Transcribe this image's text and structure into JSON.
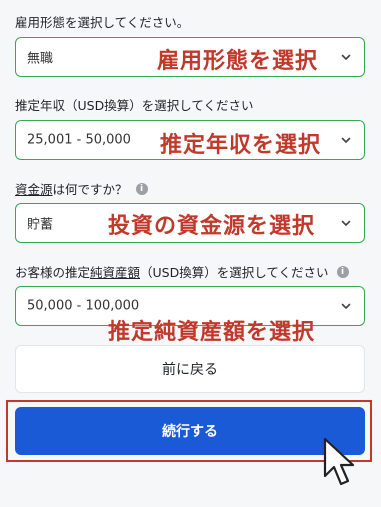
{
  "employment": {
    "label": "雇用形態を選択してください。",
    "value": "無職",
    "annotation": "雇用形態を選択"
  },
  "income": {
    "label": "推定年収（USD換算）を選択してください",
    "value": "25,001 - 50,000",
    "annotation": "推定年収を選択"
  },
  "source": {
    "label_prefix": "資金源",
    "label_rest": "は何ですか？",
    "value": "貯蓄",
    "annotation": "投資の資金源を選択",
    "info_icon": "i"
  },
  "networth": {
    "label_before": "お客様の推定",
    "label_underlined": "純資産額",
    "label_after": "（USD換算）を選択してください",
    "value": "50,000 - 100,000",
    "annotation": "推定純資産額を選択",
    "info_icon": "i"
  },
  "buttons": {
    "back": "前に戻る",
    "continue": "続行する"
  },
  "icons": {
    "chevron": "chevron-down-icon",
    "info": "info-icon",
    "cursor": "mouse-pointer-icon"
  },
  "colors": {
    "accent_green": "#34a853",
    "primary_blue": "#1a5ad6",
    "annotation_red": "#c0392b"
  }
}
